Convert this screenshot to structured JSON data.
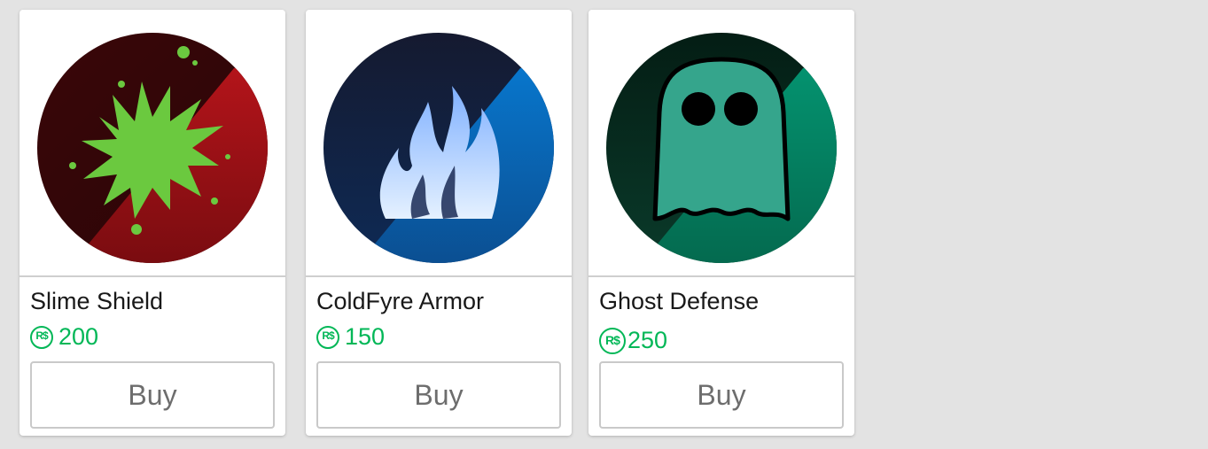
{
  "colors": {
    "background": "#e3e3e3",
    "card": "#ffffff",
    "price_green": "#02b757",
    "button_border": "#c9c9c9",
    "button_text": "#6d6d6d"
  },
  "currency_symbol": "R$",
  "items": [
    {
      "name": "Slime Shield",
      "price": "200",
      "button_label": "Buy",
      "icon": "slime-splat-icon",
      "icon_colors": [
        "#2a0608",
        "#9e0f14",
        "#6bc93f"
      ]
    },
    {
      "name": "ColdFyre Armor",
      "price": "150",
      "button_label": "Buy",
      "icon": "blue-flame-icon",
      "icon_colors": [
        "#121a33",
        "#0a6fc1",
        "#a8cbff"
      ]
    },
    {
      "name": "Ghost Defense",
      "price": "250",
      "button_label": "Buy",
      "icon": "ghost-icon",
      "icon_colors": [
        "#05271c",
        "#05876a",
        "#35a58c"
      ]
    }
  ]
}
